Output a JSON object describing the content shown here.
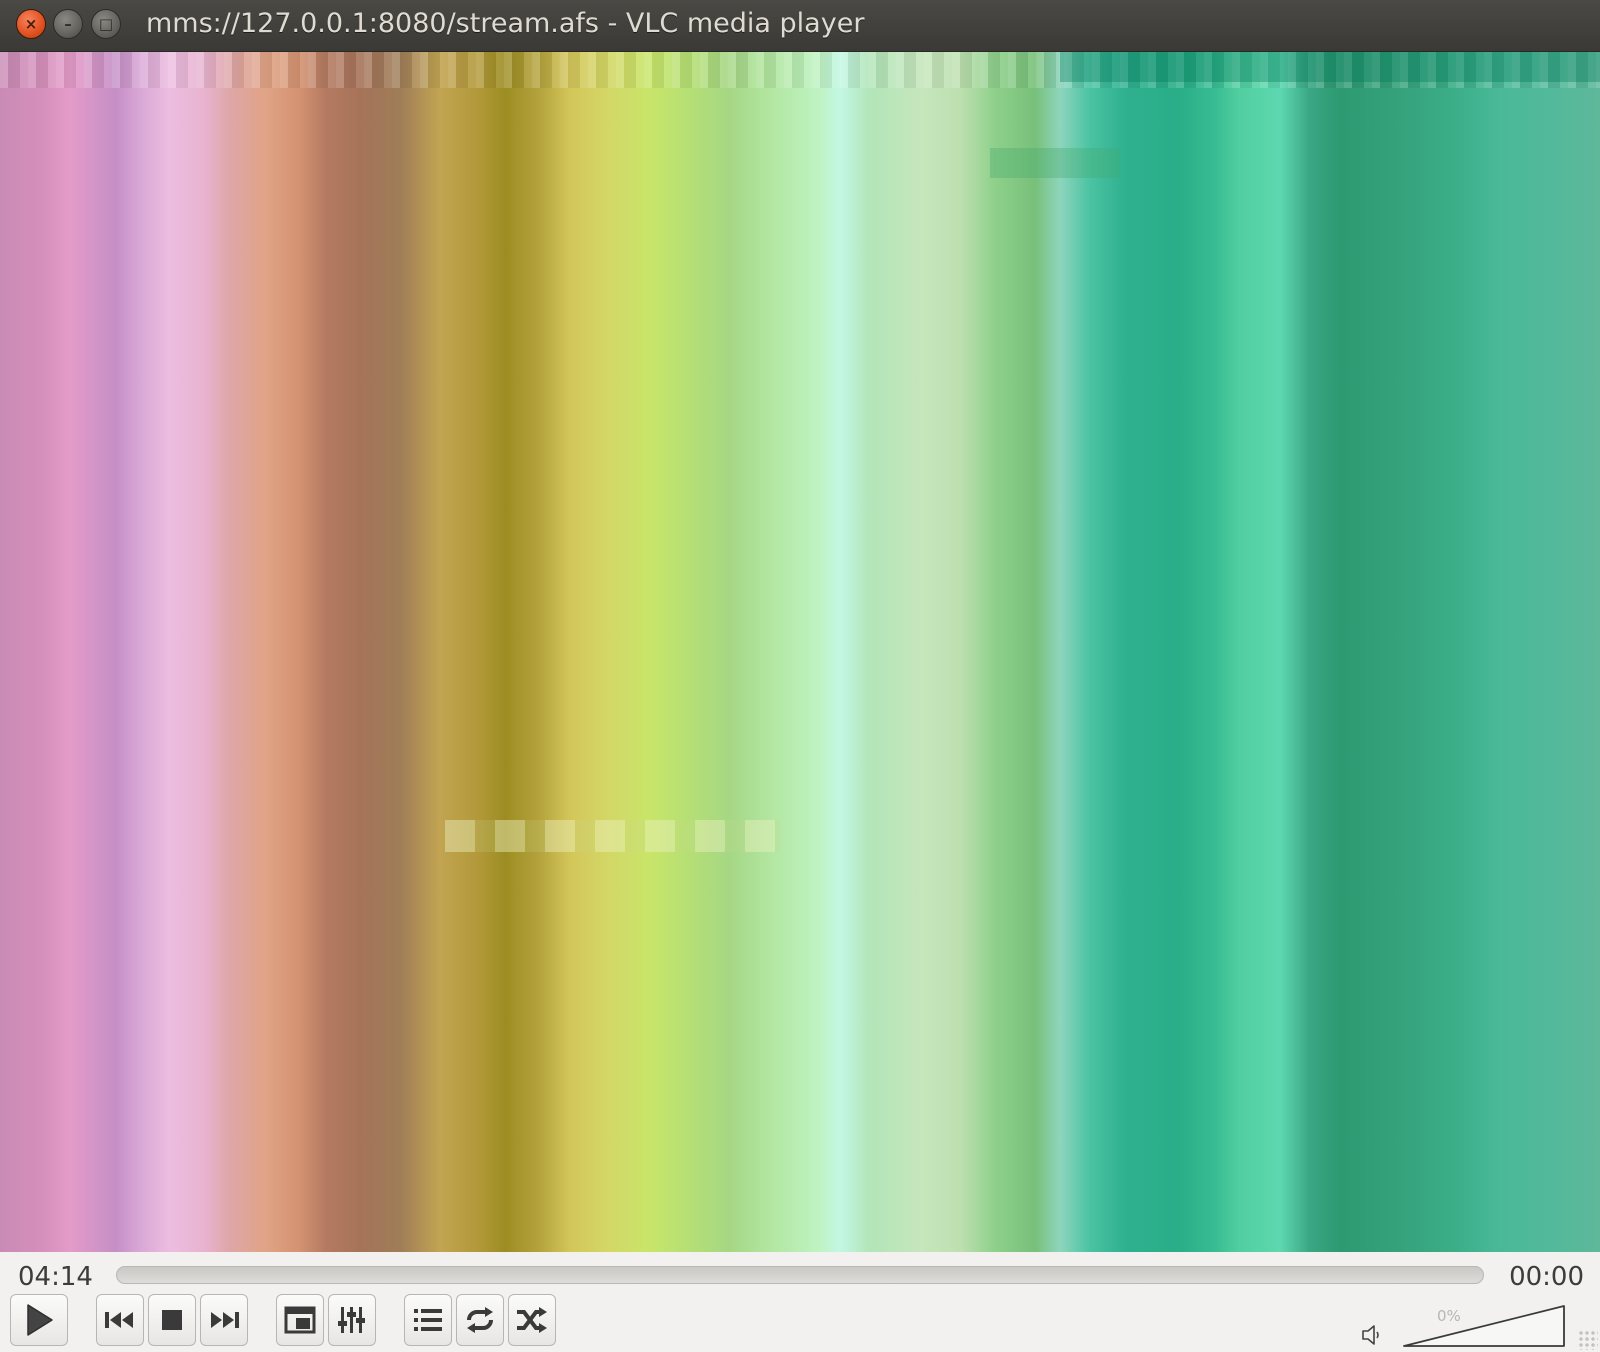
{
  "window": {
    "title": "mms://127.0.0.1:8080/stream.afs - VLC media player",
    "close_glyph": "×",
    "minimize_glyph": "–",
    "maximize_glyph": "□"
  },
  "playback": {
    "elapsed": "04:14",
    "total": "00:00",
    "position_fraction": 0
  },
  "volume": {
    "label": "0%",
    "level_fraction": 0
  },
  "controls": {
    "play": "play-icon",
    "previous": "skip-back-icon",
    "stop": "stop-icon",
    "next": "skip-forward-icon",
    "fullscreen": "fullscreen-icon",
    "extended_settings": "equalizer-sliders-icon",
    "playlist": "playlist-icon",
    "loop": "loop-icon",
    "shuffle": "shuffle-icon",
    "volume": "speaker-icon"
  },
  "colors": {
    "titlebar": "#3c3b37",
    "close_button": "#e0501f",
    "control_bar": "#f2f1f0",
    "icon": "#3a3a3a"
  }
}
